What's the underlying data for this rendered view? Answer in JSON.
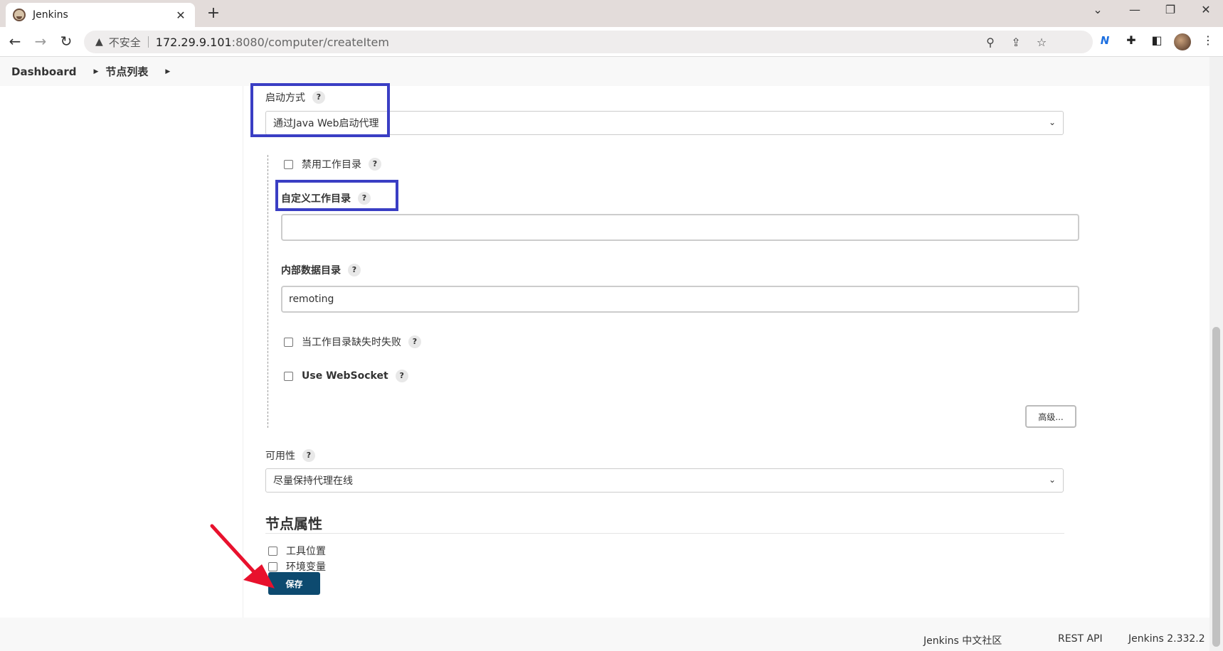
{
  "browser": {
    "tab_title": "Jenkins",
    "tab_close": "✕",
    "new_tab": "+",
    "back": "←",
    "forward": "→",
    "reload": "↻",
    "security_warning": "不安全",
    "url_host": "172.29.9.101",
    "url_path": ":8080/computer/createItem",
    "window_controls": {
      "collapse": "⌄",
      "minimize": "—",
      "restore": "❐",
      "close": "✕"
    },
    "extension_label": "N"
  },
  "breadcrumb": {
    "items": [
      "Dashboard",
      "节点列表"
    ]
  },
  "form": {
    "launch_method": {
      "label": "启动方式",
      "value": "通过Java Web启动代理"
    },
    "disable_workdir": {
      "label": "禁用工作目录",
      "checked": false
    },
    "custom_workdir": {
      "label": "自定义工作目录",
      "value": ""
    },
    "internal_data_dir": {
      "label": "内部数据目录",
      "value": "remoting"
    },
    "fail_if_workdir_missing": {
      "label": "当工作目录缺失时失败",
      "checked": false
    },
    "use_websocket": {
      "label": "Use WebSocket",
      "checked": false
    },
    "advanced_button": "高级...",
    "availability": {
      "label": "可用性",
      "value": "尽量保持代理在线"
    },
    "node_properties": {
      "title": "节点属性",
      "items": [
        {
          "label": "工具位置",
          "checked": false
        },
        {
          "label": "环境变量",
          "checked": false
        }
      ]
    },
    "save_button": "保存",
    "help_glyph": "?"
  },
  "annotations": {
    "highlight_color": "#3a3ec4",
    "arrow_color": "#e8112d"
  },
  "footer": {
    "community": "Jenkins 中文社区",
    "rest_api": "REST API",
    "version": "Jenkins 2.332.2"
  }
}
